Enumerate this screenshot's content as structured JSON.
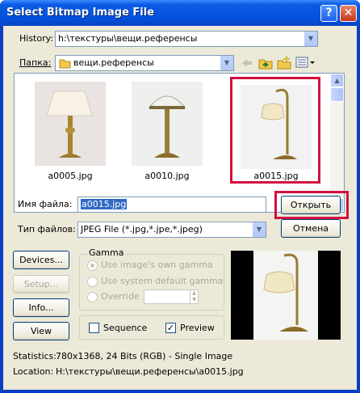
{
  "window": {
    "title": "Select Bitmap Image File"
  },
  "history": {
    "label": "History:",
    "value": "h:\\текстуры\\вещи.референсы"
  },
  "folder": {
    "label": "Папка:",
    "value": "вещи.референсы",
    "icons": [
      "folder-icon",
      "back-icon",
      "up-folder-icon",
      "new-folder-icon",
      "view-menu-icon"
    ]
  },
  "files": [
    {
      "name": "a0005.jpg",
      "selected": false
    },
    {
      "name": "a0010.jpg",
      "selected": false
    },
    {
      "name": "a0015.jpg",
      "selected": true
    }
  ],
  "filename": {
    "label": "Имя файла:",
    "value": "a0015.jpg"
  },
  "filetype": {
    "label": "Тип файлов:",
    "value": "JPEG File (*.jpg,*.jpe,*.jpeg)"
  },
  "buttons": {
    "open": "Открыть",
    "cancel": "Отмена",
    "devices": "Devices...",
    "setup": "Setup...",
    "info": "Info...",
    "view": "View"
  },
  "gamma": {
    "title": "Gamma",
    "use_image": "Use image's own gamma",
    "use_system": "Use system default gamma",
    "override": "Override",
    "override_value": ""
  },
  "options": {
    "sequence": "Sequence",
    "preview": "Preview",
    "sequence_checked": false,
    "preview_checked": true
  },
  "statistics": {
    "label": "Statistics:",
    "value": "780x1368, 24 Bits (RGB) - Single Image"
  },
  "location": {
    "label": "Location:",
    "value": "H:\\текстуры\\вещи.референсы\\a0015.jpg"
  },
  "colors": {
    "highlight": "#d1103f",
    "titlebar": "#0553e0",
    "face": "#ece9d8"
  }
}
